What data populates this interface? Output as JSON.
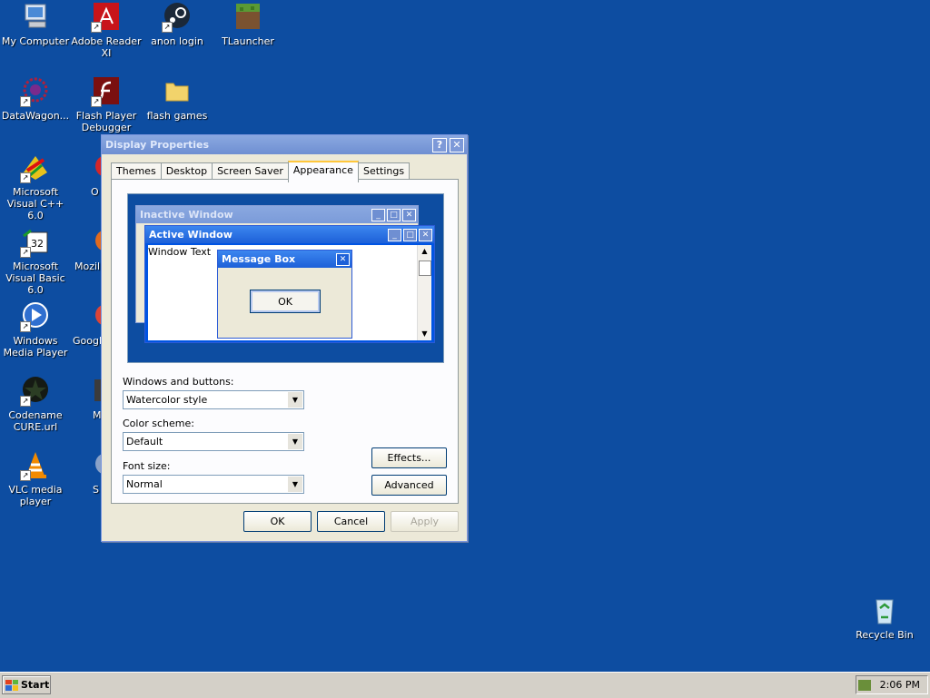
{
  "desktop": {
    "icons": [
      {
        "label": "My Computer",
        "icon": "computer-icon"
      },
      {
        "label": "Adobe Reader XI",
        "icon": "adobe-reader-icon"
      },
      {
        "label": "anon login",
        "icon": "steam-icon"
      },
      {
        "label": "TLauncher",
        "icon": "minecraft-block-icon"
      },
      {
        "label": "DataWagon...",
        "icon": "datawagon-icon"
      },
      {
        "label": "Flash Player Debugger",
        "icon": "flash-icon"
      },
      {
        "label": "flash games",
        "icon": "folder-icon"
      },
      {
        "label": "Microsoft Visual C++ 6.0",
        "icon": "visual-cpp-icon"
      },
      {
        "label": "Microsoft Visual Basic 6.0",
        "icon": "visual-basic-icon"
      },
      {
        "label": "Windows Media Player",
        "icon": "media-player-icon"
      },
      {
        "label": "Codename CURE.url",
        "icon": "codename-cure-icon"
      },
      {
        "label": "VLC media player",
        "icon": "vlc-icon"
      },
      {
        "label": "Recycle Bin",
        "icon": "recycle-bin-icon"
      }
    ],
    "partial_labels": [
      "O",
      "Mozill",
      "Google",
      "M",
      "S"
    ]
  },
  "dialog": {
    "title": "Display Properties",
    "help_button": "?",
    "close_button": "✕",
    "tabs": [
      "Themes",
      "Desktop",
      "Screen Saver",
      "Appearance",
      "Settings"
    ],
    "active_tab": "Appearance",
    "preview": {
      "inactive_title": "Inactive Window",
      "active_title": "Active Window",
      "window_text": "Window Text",
      "message_title": "Message Box",
      "ok_label": "OK"
    },
    "fields": {
      "windows_buttons_label": "Windows and buttons:",
      "windows_buttons_value": "Watercolor style",
      "color_scheme_label": "Color scheme:",
      "color_scheme_value": "Default",
      "font_size_label": "Font size:",
      "font_size_value": "Normal"
    },
    "buttons": {
      "effects": "Effects...",
      "advanced": "Advanced",
      "ok": "OK",
      "cancel": "Cancel",
      "apply": "Apply"
    }
  },
  "taskbar": {
    "start_label": "Start",
    "clock": "2:06 PM"
  },
  "colors": {
    "desktop": "#0d4da1",
    "active_title": "#1d60d8",
    "dialog_face": "#ece9d8"
  }
}
